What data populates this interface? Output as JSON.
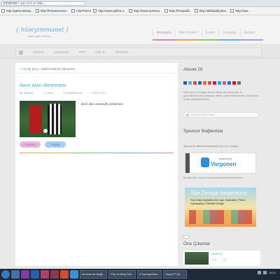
{
  "browser": {
    "url": "localhost / 127.0.0.1 / bis...",
    "bookmarks": [
      "http://gettootstrap...",
      "http://fortawesome...",
      "ClipTheme",
      "http://www.gfsha.n...",
      "http://www.w3scho...",
      "http://freepadb...",
      "http://aliklaadlyahsi...",
      "http://ww..."
    ]
  },
  "site": {
    "logo": "{ hüseyinemanet }",
    "tagline": "web tasar ım blog",
    "nav": [
      "Anasayfa",
      "Ben Kimim?",
      "Galeri",
      "Dosyalar",
      "İletişim"
    ],
    "subnav": [
      "deneme",
      "askdnsmje",
      "PHP",
      "asdf as",
      "Öbfsddsv"
    ]
  },
  "breadcrumb": {
    "home": "Sanalj Blog",
    "current": "Alakan ketime (deneme)"
  },
  "post": {
    "title": "ilave alan denemesi",
    "author": "by: Mehmet",
    "comments": "2 Comm",
    "category": "1 Kendiolbenme",
    "date": "2015-12-07",
    "excerpt": "ilave alan anasayfa aslitamam",
    "read_more": "Devamı...",
    "share": "Paylaş"
  },
  "sidebar": {
    "subscribe_title": "Abone Ol",
    "subscribe_desc": "Hele Avıçlo Güngnye abone olarak son yazılarıları ve güncellemelerden haberdar olabilir. çeşitli etkinliklerden yararlanma fırsatı yakalayabilirsiniz.",
    "email_placeholder": "Eleposte yazıp enterı...",
    "sponsor_title": "Sponsor Bağlantılar",
    "sponsor_text": "Sponsor bu sitenizin beslenmek için",
    "sponsor_link": "tırıyor",
    "sponsor_text_end": "ilanıyla...",
    "vargonen_powered": "powered by",
    "vargonen_name": "Vargonen",
    "vargonen_note_start": "Bu websitesi",
    "vargonen_note_link": "Vargonen",
    "vargonen_note_end": "sunucularında barındırılmaktadır.",
    "design_title": "The Design Inspiration",
    "design_sub": "Your Daily Inspiration for Logo, Illustration, Photo, Typography & Website Design",
    "featured_title": "Öne Çıkanlar",
    "featured_item_title": "asn1023",
    "featured_comments": "1",
    "featured_views": "1"
  },
  "taskbar": {
    "items": [
      "deneme ile Bağlı...",
      "Php de Blog Sist...",
      "C:\\xampp\\htdo...",
      "Skype™ [1] - ..."
    ],
    "clock": "16:21"
  },
  "colors": {
    "accent_blue": "#5aa9de",
    "accent_pink": "#d77fc0",
    "taskbar": "#1e2a3a"
  }
}
